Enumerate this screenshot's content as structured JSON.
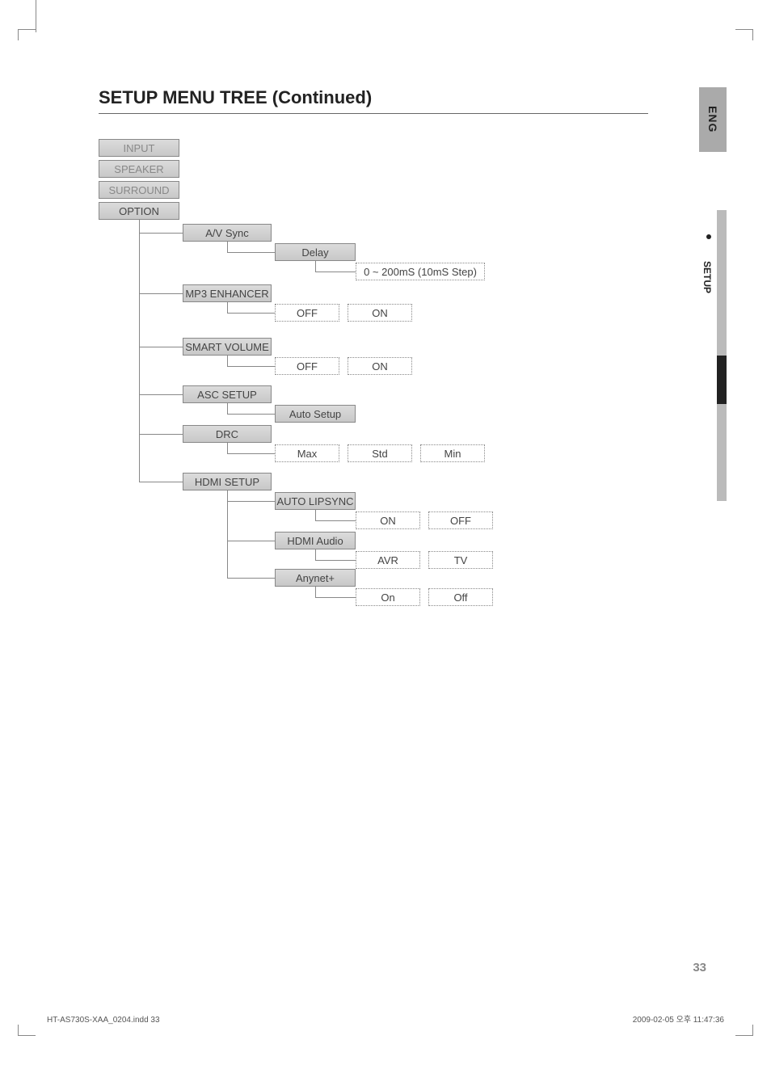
{
  "header": {
    "title": "SETUP MENU TREE (Continued)"
  },
  "side": {
    "lang": "ENG",
    "tab": "SETUP"
  },
  "menu": {
    "root": [
      {
        "label": "INPUT"
      },
      {
        "label": "SPEAKER"
      },
      {
        "label": "SURROUND"
      },
      {
        "label": "OPTION"
      }
    ],
    "option": {
      "av_sync": {
        "label": "A/V Sync",
        "sub": {
          "label": "Delay",
          "range": "0 ~ 200mS (10mS Step)"
        }
      },
      "mp3": {
        "label": "MP3 ENHANCER",
        "opts": [
          "OFF",
          "ON"
        ]
      },
      "smart": {
        "label": "SMART VOLUME",
        "opts": [
          "OFF",
          "ON"
        ]
      },
      "asc": {
        "label": "ASC SETUP",
        "sub": "Auto Setup"
      },
      "drc": {
        "label": "DRC",
        "opts": [
          "Max",
          "Std",
          "Min"
        ]
      },
      "hdmi": {
        "label": "HDMI SETUP",
        "lipsync": {
          "label": "AUTO LIPSYNC",
          "opts": [
            "ON",
            "OFF"
          ]
        },
        "audio": {
          "label": "HDMI Audio",
          "opts": [
            "AVR",
            "TV"
          ]
        },
        "anynet": {
          "label": "Anynet+",
          "opts": [
            "On",
            "Off"
          ]
        }
      }
    }
  },
  "footer": {
    "page": "33",
    "left": "HT-AS730S-XAA_0204.indd   33",
    "right": "2009-02-05   오후 11:47:36"
  }
}
